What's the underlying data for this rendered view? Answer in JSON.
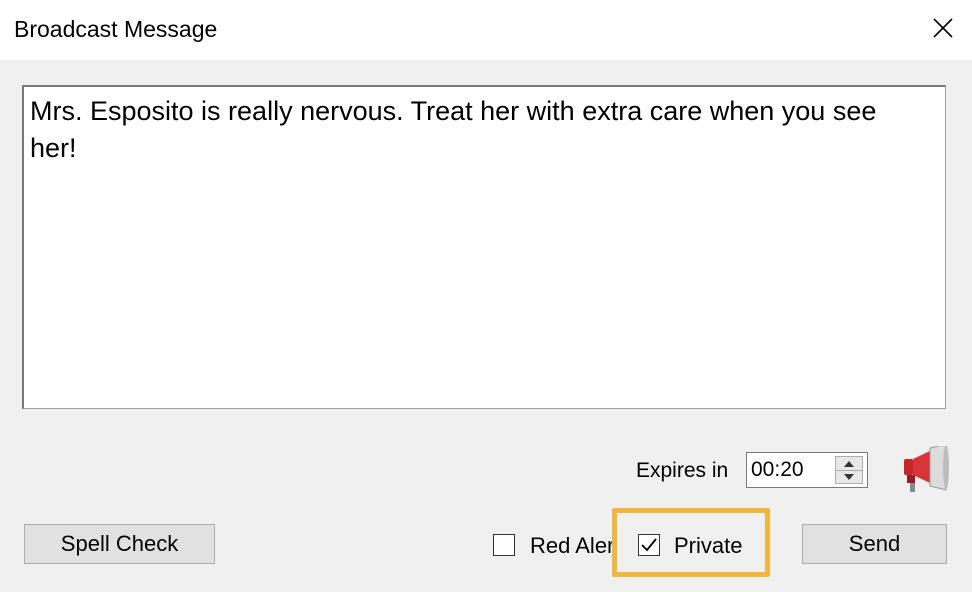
{
  "window": {
    "title": "Broadcast Message",
    "close_icon": "close-icon"
  },
  "message": {
    "text": "Mrs. Esposito is really nervous.  Treat her with extra care when you see her!"
  },
  "expires": {
    "label": "Expires in",
    "value": "00:20"
  },
  "buttons": {
    "spell_check": "Spell Check",
    "send": "Send"
  },
  "options": {
    "red_alert": {
      "label": "Red Alert",
      "checked": false
    },
    "private": {
      "label": "Private",
      "checked": true
    }
  },
  "icons": {
    "megaphone": "megaphone-icon",
    "spin_up": "chevron-up-icon",
    "spin_down": "chevron-down-icon",
    "checkmark": "checkmark-icon"
  },
  "colors": {
    "highlight": "#f2b63c",
    "megaphone_red": "#d0312d"
  }
}
